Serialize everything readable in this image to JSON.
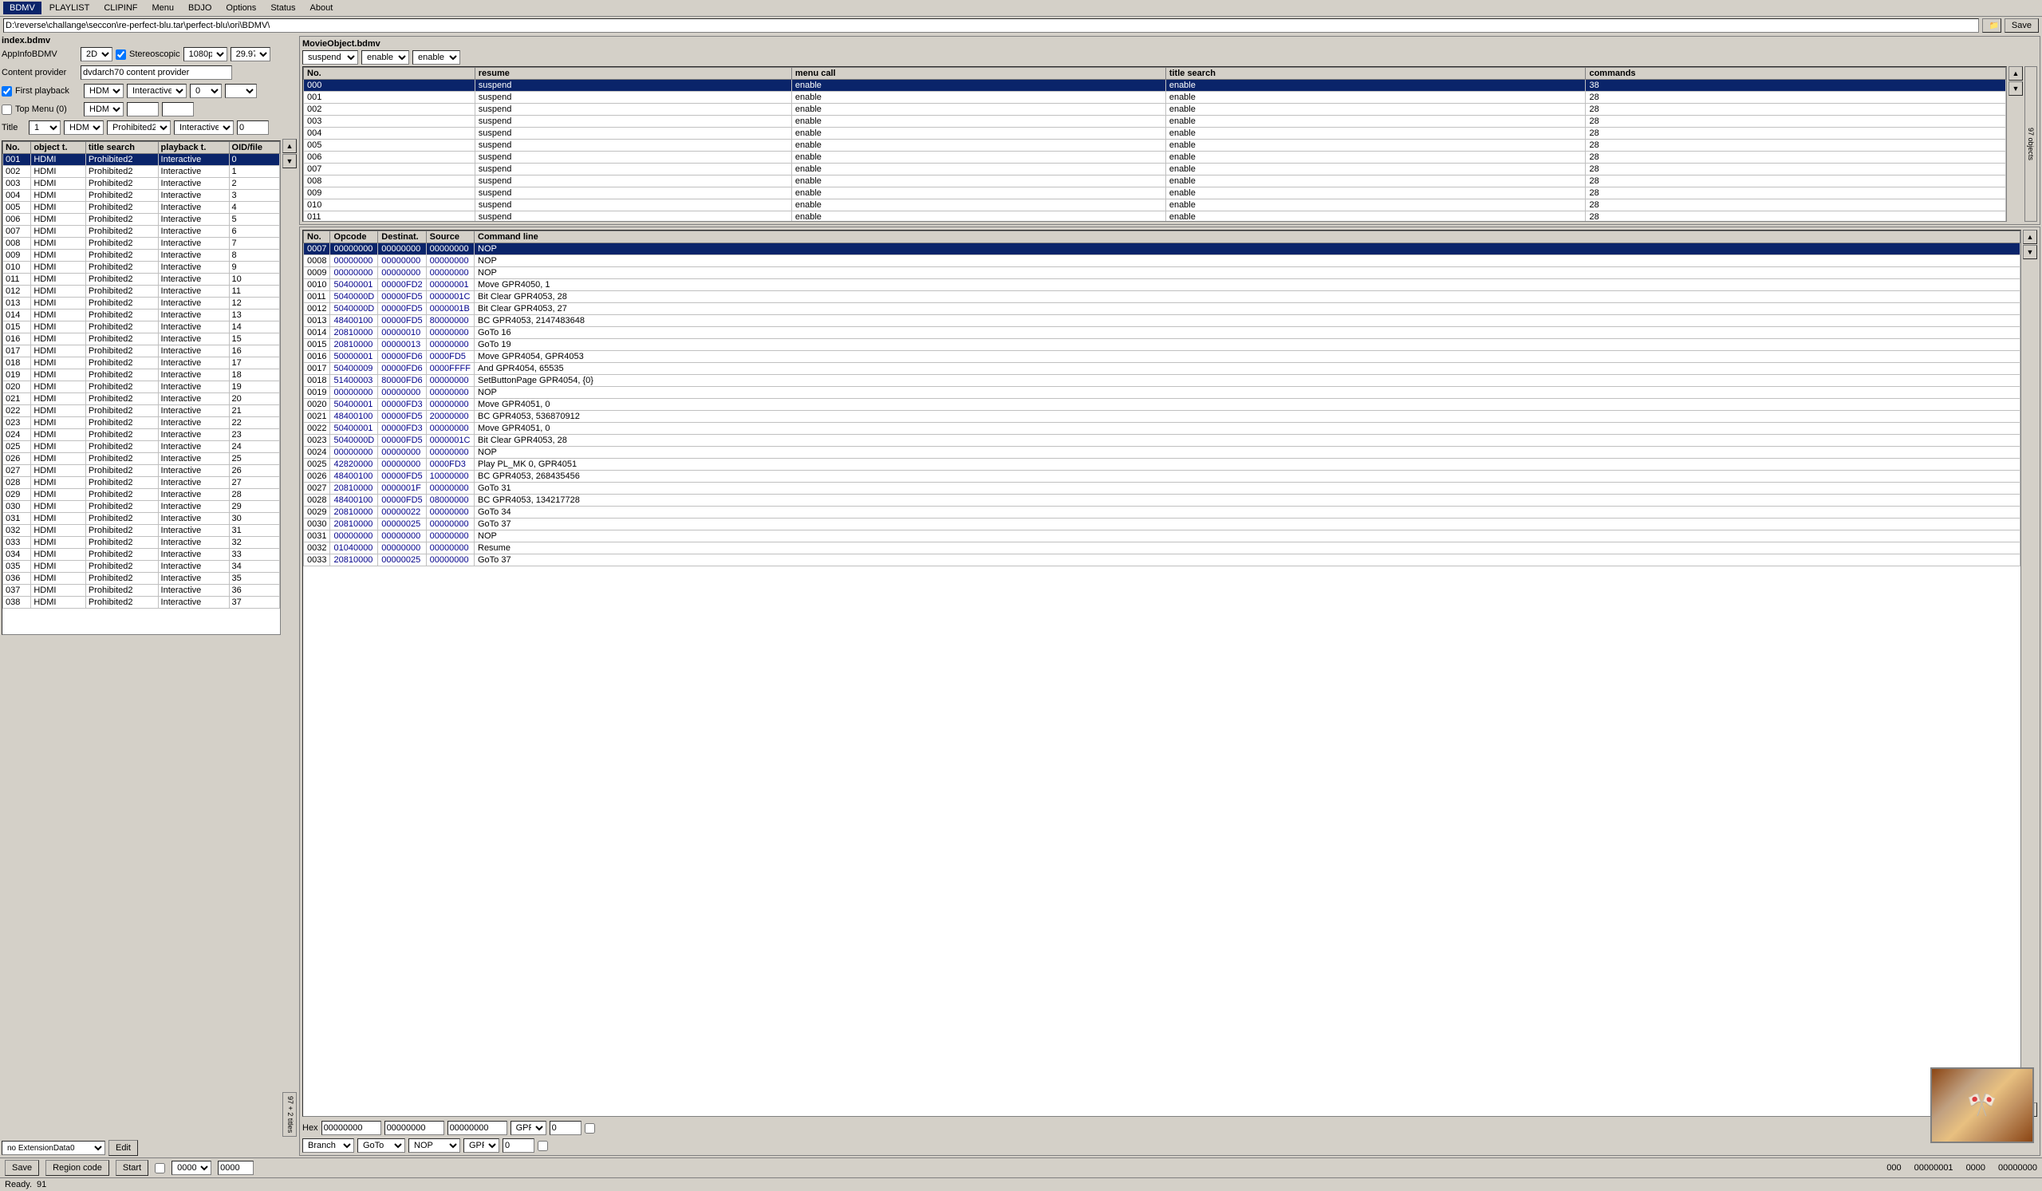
{
  "app": {
    "title": "BDMV",
    "tabs": [
      "BDMV",
      "PLAYLIST",
      "CLIPINF",
      "Menu",
      "BDJO",
      "Options",
      "Status",
      "About"
    ],
    "active_tab": "BDMV"
  },
  "path": {
    "value": "D:\\reverse\\challange\\seccon\\re-perfect-blu.tar\\perfect-blu\\ori\\BDMV\\"
  },
  "index": {
    "label": "index.bdmv",
    "app_info": {
      "label": "AppInfoBDMV",
      "value_2d": "2D",
      "stereoscopic_checked": true,
      "stereoscopic_label": "Stereoscopic",
      "resolution": "1080p",
      "framerate": "29.97"
    },
    "content_provider": {
      "label": "Content provider",
      "value": "dvdarch70 content provider"
    },
    "first_playback": {
      "label": "First playback",
      "checked": true,
      "type": "HDMI",
      "mode": "Interactive",
      "num": "0",
      "extra": ""
    },
    "top_menu": {
      "label": "Top Menu (0)",
      "checked": false,
      "type": "HDMI",
      "num": "",
      "extra": ""
    }
  },
  "title_table": {
    "columns": [
      "No.",
      "object t.",
      "title search",
      "playback t.",
      "OID/file"
    ],
    "rows": [
      {
        "no": "001",
        "obj": "HDMI",
        "title_search": "Prohibited2",
        "playback": "Interactive",
        "oid": "0",
        "selected": true
      },
      {
        "no": "002",
        "obj": "HDMI",
        "title_search": "Prohibited2",
        "playback": "Interactive",
        "oid": "1"
      },
      {
        "no": "003",
        "obj": "HDMI",
        "title_search": "Prohibited2",
        "playback": "Interactive",
        "oid": "2"
      },
      {
        "no": "004",
        "obj": "HDMI",
        "title_search": "Prohibited2",
        "playback": "Interactive",
        "oid": "3"
      },
      {
        "no": "005",
        "obj": "HDMI",
        "title_search": "Prohibited2",
        "playback": "Interactive",
        "oid": "4"
      },
      {
        "no": "006",
        "obj": "HDMI",
        "title_search": "Prohibited2",
        "playback": "Interactive",
        "oid": "5"
      },
      {
        "no": "007",
        "obj": "HDMI",
        "title_search": "Prohibited2",
        "playback": "Interactive",
        "oid": "6"
      },
      {
        "no": "008",
        "obj": "HDMI",
        "title_search": "Prohibited2",
        "playback": "Interactive",
        "oid": "7"
      },
      {
        "no": "009",
        "obj": "HDMI",
        "title_search": "Prohibited2",
        "playback": "Interactive",
        "oid": "8"
      },
      {
        "no": "010",
        "obj": "HDMI",
        "title_search": "Prohibited2",
        "playback": "Interactive",
        "oid": "9"
      },
      {
        "no": "011",
        "obj": "HDMI",
        "title_search": "Prohibited2",
        "playback": "Interactive",
        "oid": "10"
      },
      {
        "no": "012",
        "obj": "HDMI",
        "title_search": "Prohibited2",
        "playback": "Interactive",
        "oid": "11"
      },
      {
        "no": "013",
        "obj": "HDMI",
        "title_search": "Prohibited2",
        "playback": "Interactive",
        "oid": "12"
      },
      {
        "no": "014",
        "obj": "HDMI",
        "title_search": "Prohibited2",
        "playback": "Interactive",
        "oid": "13"
      },
      {
        "no": "015",
        "obj": "HDMI",
        "title_search": "Prohibited2",
        "playback": "Interactive",
        "oid": "14"
      },
      {
        "no": "016",
        "obj": "HDMI",
        "title_search": "Prohibited2",
        "playback": "Interactive",
        "oid": "15"
      },
      {
        "no": "017",
        "obj": "HDMI",
        "title_search": "Prohibited2",
        "playback": "Interactive",
        "oid": "16"
      },
      {
        "no": "018",
        "obj": "HDMI",
        "title_search": "Prohibited2",
        "playback": "Interactive",
        "oid": "17"
      },
      {
        "no": "019",
        "obj": "HDMI",
        "title_search": "Prohibited2",
        "playback": "Interactive",
        "oid": "18"
      },
      {
        "no": "020",
        "obj": "HDMI",
        "title_search": "Prohibited2",
        "playback": "Interactive",
        "oid": "19"
      },
      {
        "no": "021",
        "obj": "HDMI",
        "title_search": "Prohibited2",
        "playback": "Interactive",
        "oid": "20"
      },
      {
        "no": "022",
        "obj": "HDMI",
        "title_search": "Prohibited2",
        "playback": "Interactive",
        "oid": "21"
      },
      {
        "no": "023",
        "obj": "HDMI",
        "title_search": "Prohibited2",
        "playback": "Interactive",
        "oid": "22"
      },
      {
        "no": "024",
        "obj": "HDMI",
        "title_search": "Prohibited2",
        "playback": "Interactive",
        "oid": "23"
      },
      {
        "no": "025",
        "obj": "HDMI",
        "title_search": "Prohibited2",
        "playback": "Interactive",
        "oid": "24"
      },
      {
        "no": "026",
        "obj": "HDMI",
        "title_search": "Prohibited2",
        "playback": "Interactive",
        "oid": "25"
      },
      {
        "no": "027",
        "obj": "HDMI",
        "title_search": "Prohibited2",
        "playback": "Interactive",
        "oid": "26"
      },
      {
        "no": "028",
        "obj": "HDMI",
        "title_search": "Prohibited2",
        "playback": "Interactive",
        "oid": "27"
      },
      {
        "no": "029",
        "obj": "HDMI",
        "title_search": "Prohibited2",
        "playback": "Interactive",
        "oid": "28"
      },
      {
        "no": "030",
        "obj": "HDMI",
        "title_search": "Prohibited2",
        "playback": "Interactive",
        "oid": "29"
      },
      {
        "no": "031",
        "obj": "HDMI",
        "title_search": "Prohibited2",
        "playback": "Interactive",
        "oid": "30"
      },
      {
        "no": "032",
        "obj": "HDMI",
        "title_search": "Prohibited2",
        "playback": "Interactive",
        "oid": "31"
      },
      {
        "no": "033",
        "obj": "HDMI",
        "title_search": "Prohibited2",
        "playback": "Interactive",
        "oid": "32"
      },
      {
        "no": "034",
        "obj": "HDMI",
        "title_search": "Prohibited2",
        "playback": "Interactive",
        "oid": "33"
      },
      {
        "no": "035",
        "obj": "HDMI",
        "title_search": "Prohibited2",
        "playback": "Interactive",
        "oid": "34"
      },
      {
        "no": "036",
        "obj": "HDMI",
        "title_search": "Prohibited2",
        "playback": "Interactive",
        "oid": "35"
      },
      {
        "no": "037",
        "obj": "HDMI",
        "title_search": "Prohibited2",
        "playback": "Interactive",
        "oid": "36"
      },
      {
        "no": "038",
        "obj": "HDMI",
        "title_search": "Prohibited2",
        "playback": "Interactive",
        "oid": "37"
      }
    ]
  },
  "left_selectors": {
    "title_num": "1",
    "hdmi_1": "HDMI",
    "prohibited2": "Prohibited2",
    "interactive": "Interactive",
    "zero_1": "0",
    "hdmi_2": "HDMI",
    "no_ext": "no ExtensionData0",
    "edit_btn": "Edit"
  },
  "movie_object": {
    "title": "MovieObject.bdmv",
    "suspend_select": "suspend",
    "enable_1": "enable",
    "enable_2": "enable",
    "columns": [
      "No.",
      "resume",
      "menu call",
      "title search",
      "commands"
    ],
    "rows": [
      {
        "no": "000",
        "resume": "suspend",
        "menu_call": "enable",
        "title_search": "enable",
        "commands": "38",
        "selected": true
      },
      {
        "no": "001",
        "resume": "suspend",
        "menu_call": "enable",
        "title_search": "enable",
        "commands": "28"
      },
      {
        "no": "002",
        "resume": "suspend",
        "menu_call": "enable",
        "title_search": "enable",
        "commands": "28"
      },
      {
        "no": "003",
        "resume": "suspend",
        "menu_call": "enable",
        "title_search": "enable",
        "commands": "28"
      },
      {
        "no": "004",
        "resume": "suspend",
        "menu_call": "enable",
        "title_search": "enable",
        "commands": "28"
      },
      {
        "no": "005",
        "resume": "suspend",
        "menu_call": "enable",
        "title_search": "enable",
        "commands": "28"
      },
      {
        "no": "006",
        "resume": "suspend",
        "menu_call": "enable",
        "title_search": "enable",
        "commands": "28"
      },
      {
        "no": "007",
        "resume": "suspend",
        "menu_call": "enable",
        "title_search": "enable",
        "commands": "28"
      },
      {
        "no": "008",
        "resume": "suspend",
        "menu_call": "enable",
        "title_search": "enable",
        "commands": "28"
      },
      {
        "no": "009",
        "resume": "suspend",
        "menu_call": "enable",
        "title_search": "enable",
        "commands": "28"
      },
      {
        "no": "010",
        "resume": "suspend",
        "menu_call": "enable",
        "title_search": "enable",
        "commands": "28"
      },
      {
        "no": "011",
        "resume": "suspend",
        "menu_call": "enable",
        "title_search": "enable",
        "commands": "28"
      }
    ]
  },
  "commands": {
    "columns": [
      "No.",
      "Opcode",
      "Destinat.",
      "Source",
      "Command line"
    ],
    "rows": [
      {
        "no": "0007",
        "opcode": "00000000",
        "dest": "00000000",
        "source": "00000000",
        "cmd": "NOP",
        "selected": true
      },
      {
        "no": "0008",
        "opcode": "00000000",
        "dest": "00000000",
        "source": "00000000",
        "cmd": "NOP"
      },
      {
        "no": "0009",
        "opcode": "00000000",
        "dest": "00000000",
        "source": "00000000",
        "cmd": "NOP"
      },
      {
        "no": "0010",
        "opcode": "50400001",
        "dest": "00000FD2",
        "source": "00000001",
        "cmd": "Move GPR4050, 1"
      },
      {
        "no": "0011",
        "opcode": "5040000D",
        "dest": "00000FD5",
        "source": "0000001C",
        "cmd": "Bit Clear GPR4053, 28"
      },
      {
        "no": "0012",
        "opcode": "5040000D",
        "dest": "00000FD5",
        "source": "0000001B",
        "cmd": "Bit Clear GPR4053, 27"
      },
      {
        "no": "0013",
        "opcode": "48400100",
        "dest": "00000FD5",
        "source": "80000000",
        "cmd": "BC GPR4053, 2147483648"
      },
      {
        "no": "0014",
        "opcode": "20810000",
        "dest": "00000010",
        "source": "00000000",
        "cmd": "GoTo 16"
      },
      {
        "no": "0015",
        "opcode": "20810000",
        "dest": "00000013",
        "source": "00000000",
        "cmd": "GoTo 19"
      },
      {
        "no": "0016",
        "opcode": "50000001",
        "dest": "00000FD6",
        "source": "0000FD5",
        "cmd": "Move GPR4054, GPR4053"
      },
      {
        "no": "0017",
        "opcode": "50400009",
        "dest": "00000FD6",
        "source": "0000FFFF",
        "cmd": "And GPR4054, 65535"
      },
      {
        "no": "0018",
        "opcode": "51400003",
        "dest": "80000FD6",
        "source": "00000000",
        "cmd": "SetButtonPage GPR4054, {0}"
      },
      {
        "no": "0019",
        "opcode": "00000000",
        "dest": "00000000",
        "source": "00000000",
        "cmd": "NOP"
      },
      {
        "no": "0020",
        "opcode": "50400001",
        "dest": "00000FD3",
        "source": "00000000",
        "cmd": "Move GPR4051, 0"
      },
      {
        "no": "0021",
        "opcode": "48400100",
        "dest": "00000FD5",
        "source": "20000000",
        "cmd": "BC GPR4053, 536870912"
      },
      {
        "no": "0022",
        "opcode": "50400001",
        "dest": "00000FD3",
        "source": "00000000",
        "cmd": "Move GPR4051, 0"
      },
      {
        "no": "0023",
        "opcode": "5040000D",
        "dest": "00000FD5",
        "source": "0000001C",
        "cmd": "Bit Clear GPR4053, 28"
      },
      {
        "no": "0024",
        "opcode": "00000000",
        "dest": "00000000",
        "source": "00000000",
        "cmd": "NOP"
      },
      {
        "no": "0025",
        "opcode": "42820000",
        "dest": "00000000",
        "source": "0000FD3",
        "cmd": "Play PL_MK 0, GPR4051"
      },
      {
        "no": "0026",
        "opcode": "48400100",
        "dest": "00000FD5",
        "source": "10000000",
        "cmd": "BC GPR4053, 268435456"
      },
      {
        "no": "0027",
        "opcode": "20810000",
        "dest": "0000001F",
        "source": "00000000",
        "cmd": "GoTo 31"
      },
      {
        "no": "0028",
        "opcode": "48400100",
        "dest": "00000FD5",
        "source": "08000000",
        "cmd": "BC GPR4053, 134217728"
      },
      {
        "no": "0029",
        "opcode": "20810000",
        "dest": "00000022",
        "source": "00000000",
        "cmd": "GoTo 34"
      },
      {
        "no": "0030",
        "opcode": "20810000",
        "dest": "00000025",
        "source": "00000000",
        "cmd": "GoTo 37"
      },
      {
        "no": "0031",
        "opcode": "00000000",
        "dest": "00000000",
        "source": "00000000",
        "cmd": "NOP"
      },
      {
        "no": "0032",
        "opcode": "01040000",
        "dest": "00000000",
        "source": "00000000",
        "cmd": "Resume"
      },
      {
        "no": "0033",
        "opcode": "20810000",
        "dest": "00000025",
        "source": "00000000",
        "cmd": "GoTo 37"
      }
    ]
  },
  "hex_bar": {
    "val1": "00000000",
    "val2": "00000000",
    "val3": "00000000",
    "gpr_sel": "GPR",
    "gpr_val": "0"
  },
  "branch_bar": {
    "branch_sel": "Branch",
    "goto_sel": "GoTo",
    "nop_sel": "NOP",
    "gpr_sel": "GPR",
    "gpr_val": "0"
  },
  "bottom_controls": {
    "save_btn": "Save",
    "region_code_btn": "Region code",
    "start_btn": "Start",
    "val1": "0000",
    "val2": "0000",
    "right_vals": [
      "000",
      "00000001",
      "0000",
      "00000000"
    ]
  },
  "status_bar": {
    "text": "Ready.",
    "count": "91"
  },
  "sidebar_right": {
    "label": "97 objects"
  },
  "sidebar_right2": {
    "label": "97 + 2 titles"
  }
}
